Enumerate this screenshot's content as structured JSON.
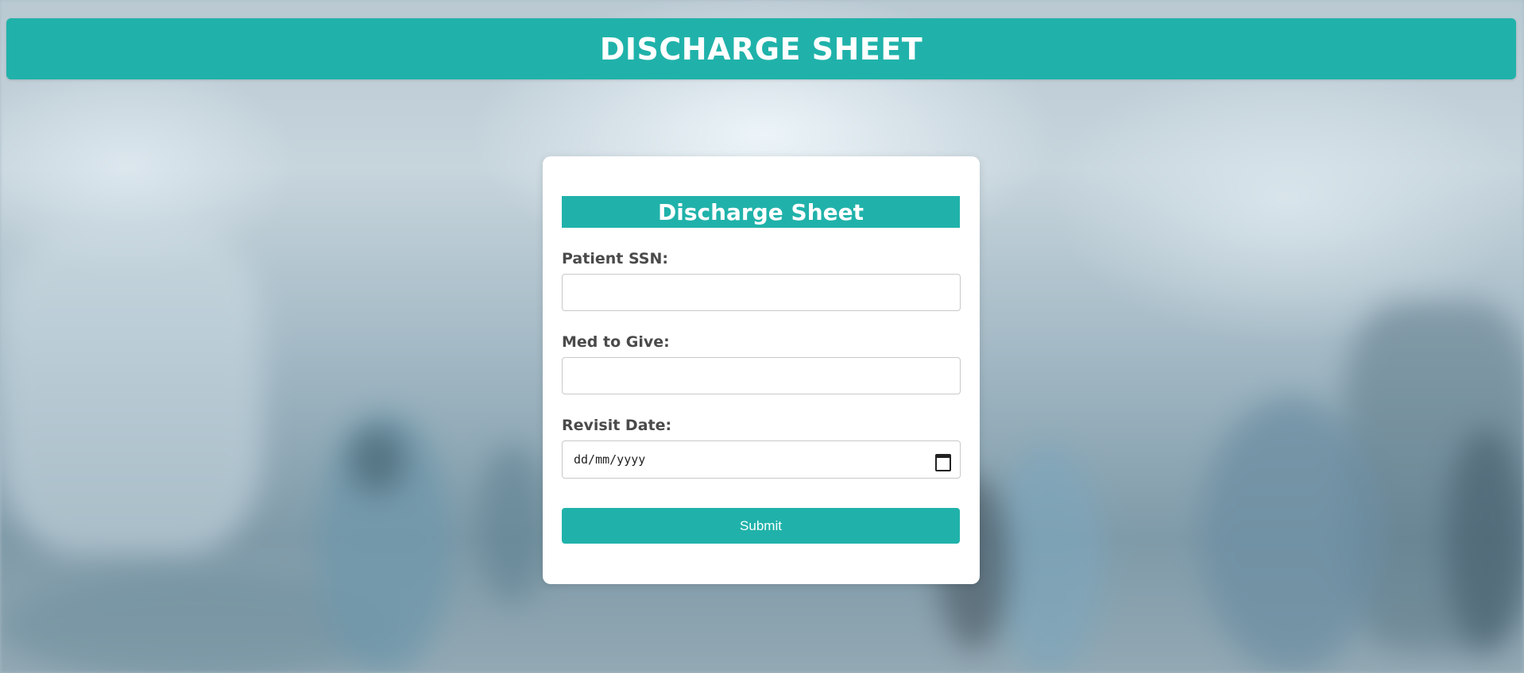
{
  "header": {
    "title": "DISCHARGE SHEET"
  },
  "form": {
    "title": "Discharge Sheet",
    "fields": [
      {
        "label": "Patient SSN:",
        "value": ""
      },
      {
        "label": "Med to Give:",
        "value": ""
      },
      {
        "label": "Revisit Date:",
        "placeholder": "dd/mm/yyyy",
        "icon": "calendar-icon"
      }
    ],
    "submit_label": "Submit"
  },
  "colors": {
    "accent": "#20b2aa",
    "card_background": "#ffffff",
    "label_text": "#4a4a4a"
  }
}
